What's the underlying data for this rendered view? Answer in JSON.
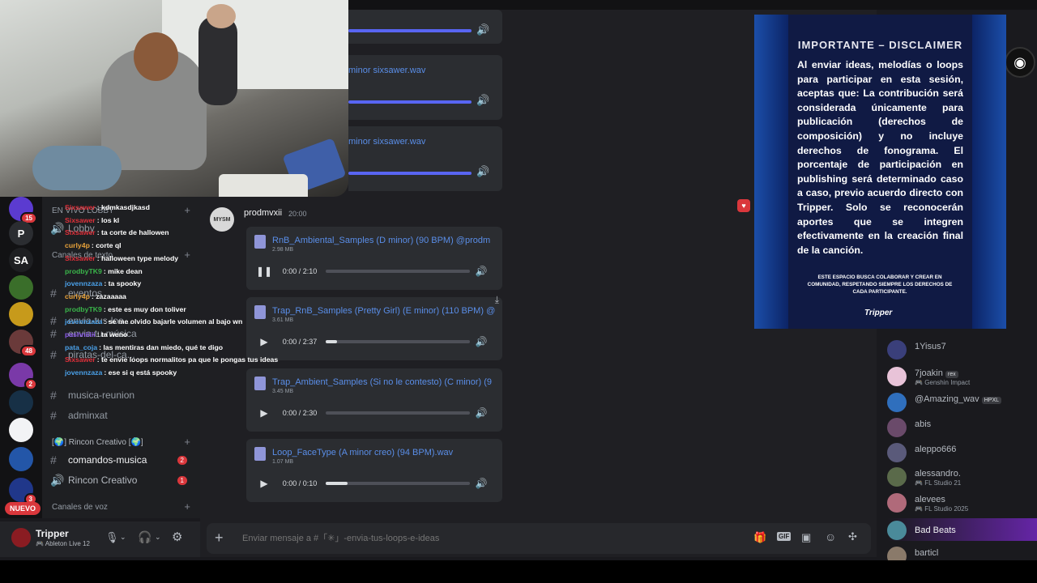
{
  "colors": {
    "accent": "#5865f2",
    "link": "#5a8ee8",
    "danger": "#da373c",
    "online": "#23a55a"
  },
  "servers": [
    {
      "label": "",
      "badge": "15",
      "color": "#5b3bd0"
    },
    {
      "label": "P",
      "badge": "",
      "color": "#2b2d31"
    },
    {
      "label": "SA",
      "badge": "",
      "color": "#1e1f22"
    },
    {
      "label": "",
      "badge": "",
      "color": "#3a6e2a"
    },
    {
      "label": "",
      "badge": "",
      "color": "#c79a1b"
    },
    {
      "label": "",
      "badge": "48",
      "color": "#6a3a3a"
    },
    {
      "label": "",
      "badge": "2",
      "color": "#7a39a8"
    },
    {
      "label": "",
      "badge": "",
      "color": "#173046"
    },
    {
      "label": "",
      "badge": "",
      "color": "#f2f3f5"
    },
    {
      "label": "",
      "badge": "",
      "color": "#2356a8"
    },
    {
      "label": "",
      "badge": "3",
      "color": "#20378a"
    }
  ],
  "new_label": "NUEVO",
  "channels": {
    "voice_top": "EN VIVO LOBBY",
    "lobby": "Lobby",
    "text_category": "Canales de texto",
    "items": [
      {
        "name": "eventos",
        "count": ""
      },
      {
        "name": "envia-tus-loo...",
        "count": ""
      },
      {
        "name": "envia-tu-música",
        "count": ""
      },
      {
        "name": "piratas-del-ca...",
        "count": ""
      },
      {
        "name": "musica-reunion",
        "count": ""
      },
      {
        "name": "adminxat",
        "count": ""
      }
    ],
    "rincon_category": "[🌍] Rincon Creativo [🌍]",
    "comandos": "comandos-musica",
    "comandos_count": "2",
    "rincon_voice": "Rincon Creativo",
    "rincon_count": "1",
    "voice_category": "Canales de voz"
  },
  "user": {
    "name": "Tripper",
    "status": "Ableton Live 12"
  },
  "live_chat": [
    {
      "user": "Sixsawer",
      "color": "#e0303a",
      "text": ": kdmkasdjkasd"
    },
    {
      "user": "Sixsawer",
      "color": "#e0303a",
      "text": ": los kl"
    },
    {
      "user": "Sixsawer",
      "color": "#e0303a",
      "text": ": ta corte de hallowen"
    },
    {
      "user": "curly4p",
      "color": "#e8a23a",
      "text": ": corte ql"
    },
    {
      "user": "Sixsawer",
      "color": "#e0303a",
      "text": ": halloween type melody"
    },
    {
      "user": "prodbyTK9",
      "color": "#3ab54a",
      "text": ": mike dean"
    },
    {
      "user": "jovennzaza",
      "color": "#4aa0e8",
      "text": ": ta spooky"
    },
    {
      "user": "curly4p",
      "color": "#e8a23a",
      "text": ": zazaaaaa"
    },
    {
      "user": "prodbyTK9",
      "color": "#3ab54a",
      "text": ": este es muy don toliver"
    },
    {
      "user": "jovennzaza",
      "color": "#4aa0e8",
      "text": ": se me olvido bajarle volumen al bajo wn"
    },
    {
      "user": "pashniiiii",
      "color": "#8a5ae8",
      "text": ": ta weno"
    },
    {
      "user": "pata_coja",
      "color": "#4aa0e8",
      "text": ": las mentiras dan miedo, qué te digo"
    },
    {
      "user": "Sixsawer",
      "color": "#e0303a",
      "text": ": te envie loops normalitos pa que le pongas tus ideas"
    },
    {
      "user": "jovennzaza",
      "color": "#4aa0e8",
      "text": ": ese si q está spooky"
    }
  ],
  "top_attachments": [
    {
      "name": ""
    },
    {
      "name": "minor sixsawer.wav"
    },
    {
      "name": "minor sixsawer.wav"
    }
  ],
  "message": {
    "author": "prodmvxii",
    "time": "20:00"
  },
  "attachments": [
    {
      "name": "RnB_Ambiental_Samples (D minor) (90 BPM) @prodm",
      "size": "2.98 MB",
      "time": "0:00 / 2:10",
      "state": "pause",
      "progress": 0.0
    },
    {
      "name": "Trap_RnB_Samples (Pretty Girl) (E minor) (110 BPM) @",
      "size": "3.61 MB",
      "time": "0:00 / 2:37",
      "state": "play",
      "progress": 0.08
    },
    {
      "name": "Trap_Ambient_Samples (Si no le contesto) (C minor) (9",
      "size": "3.45 MB",
      "time": "0:00 / 2:30",
      "state": "play",
      "progress": 0.0
    },
    {
      "name": "Loop_FaceType (A minor creo) (94 BPM).wav",
      "size": "1.07 MB",
      "time": "0:00 / 0:10",
      "state": "play",
      "progress": 0.15
    }
  ],
  "composer": {
    "placeholder": "Enviar mensaje a #「✳」-envia-tus-loops-e-ideas"
  },
  "disclaimer": {
    "title": "IMPORTANTE – DISCLAIMER",
    "body": "Al enviar ideas, melodías o loops para participar en esta sesión, aceptas que: La contribución será considerada únicamente para publicación (derechos de composición) y no incluye derechos de fonograma. El porcentaje de participación en publishing será determinado caso a caso, previo acuerdo directo con Tripper. Solo se reconocerán aportes que se integren efectivamente en la creación final de la canción.",
    "footer": "ESTE ESPACIO BUSCA COLABORAR Y CREAR EN COMUNIDAD, RESPETANDO SIEMPRE LOS DERECHOS DE CADA PARTICIPANTE.",
    "signature": "Tripper"
  },
  "members": [
    {
      "name": "1Yisus7",
      "status": "",
      "color": "#3a3f7a"
    },
    {
      "name": "7joakin",
      "tag": "rex",
      "status": "Genshin Impact",
      "color": "#e8c3d8"
    },
    {
      "name": "@Amazing_wav",
      "tag": "HPXL",
      "status": "",
      "color": "#2f6fbd"
    },
    {
      "name": "abis",
      "status": "",
      "color": "#6a4a6a"
    },
    {
      "name": "aleppo666",
      "status": "",
      "color": "#5a5a7a"
    },
    {
      "name": "alessandro.",
      "status": "FL Studio 21",
      "color": "#5a6a4a"
    },
    {
      "name": "alevees",
      "status": "FL Studio 2025",
      "color": "#b06a7a"
    },
    {
      "name": "Bad Beats",
      "status": "",
      "color": "#4a8a9a"
    },
    {
      "name": "barticl",
      "status": "",
      "color": "#8a7a6a"
    }
  ]
}
